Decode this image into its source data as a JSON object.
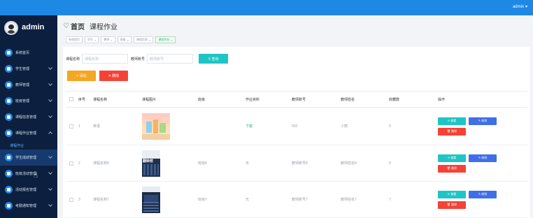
{
  "header": {
    "user": "admin ▾"
  },
  "brand": {
    "name": "admin"
  },
  "sidebar": {
    "items": [
      {
        "label": "系统首页"
      },
      {
        "label": "学生管理"
      },
      {
        "label": "教师管理"
      },
      {
        "label": "班级管理"
      },
      {
        "label": "课程信息管理"
      },
      {
        "label": "课程作业管理"
      },
      {
        "label": "学生成绩管理"
      },
      {
        "label": "班级活动管理"
      },
      {
        "label": "活动报名管理"
      },
      {
        "label": "考勤通知管理"
      }
    ],
    "submenu": "课程作业"
  },
  "breadcrumb": {
    "home": "首页",
    "page": "课程作业"
  },
  "tags": [
    "系统首页",
    "学生",
    "教师",
    "班级",
    "课程信息",
    "课程作业"
  ],
  "search": {
    "label1": "课程名称",
    "placeholder1": "课程名称",
    "label2": "教师账号",
    "placeholder2": "教师账号",
    "button": "⚲ 查询"
  },
  "actions": {
    "add": "+ 添加",
    "delete": "✕ 删除"
  },
  "table": {
    "headers": [
      "序号",
      "课程名称",
      "课程图片",
      "班级",
      "作业资料",
      "教师账号",
      "教师姓名",
      "收藏数",
      "操作"
    ],
    "rows": [
      {
        "no": "1",
        "name": "英语",
        "class": "",
        "file": "下载",
        "tid": "002",
        "tname": "小丽",
        "fav": "0"
      },
      {
        "no": "2",
        "name": "课程名称8",
        "class": "班级8",
        "file": "无",
        "tid": "教师账号8",
        "tname": "教师姓名8",
        "fav": "8"
      },
      {
        "no": "3",
        "name": "课程名称7",
        "class": "班级7",
        "file": "无",
        "tid": "教师账号7",
        "tname": "教师姓名7",
        "fav": "7"
      }
    ],
    "thumb2_text": "翻转校"
  },
  "row_buttons": {
    "view": "⊙ 查看",
    "edit": "✎ 修改",
    "remove": "🗑 删除"
  },
  "colors": {
    "topbar": "#1e88e5",
    "sidebar": "#0c1f3f",
    "accent": "#1fc5c5",
    "add": "#f5a623",
    "danger": "#f44336",
    "edit": "#3f6ee8"
  }
}
